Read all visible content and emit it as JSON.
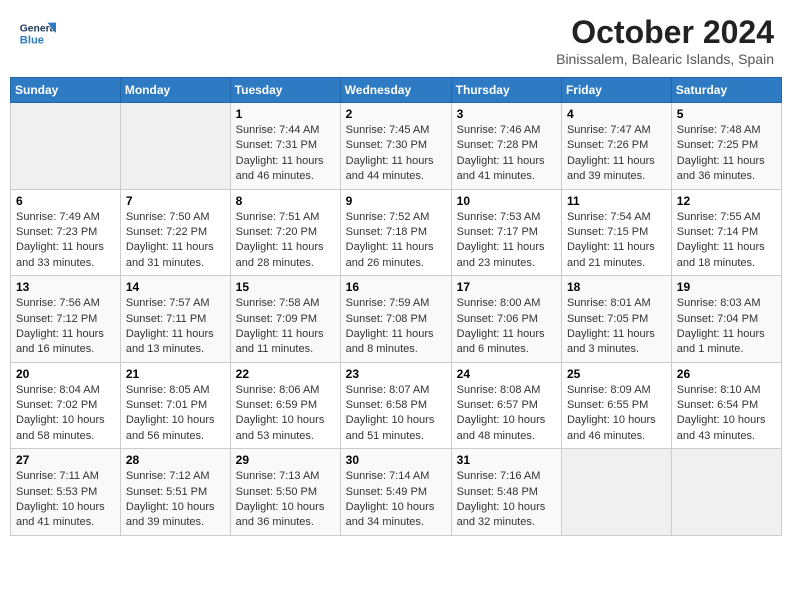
{
  "header": {
    "logo_text_general": "General",
    "logo_text_blue": "Blue",
    "month_title": "October 2024",
    "subtitle": "Binissalem, Balearic Islands, Spain"
  },
  "days_of_week": [
    "Sunday",
    "Monday",
    "Tuesday",
    "Wednesday",
    "Thursday",
    "Friday",
    "Saturday"
  ],
  "weeks": [
    [
      {
        "day": "",
        "data": ""
      },
      {
        "day": "",
        "data": ""
      },
      {
        "day": "1",
        "data": "Sunrise: 7:44 AM\nSunset: 7:31 PM\nDaylight: 11 hours and 46 minutes."
      },
      {
        "day": "2",
        "data": "Sunrise: 7:45 AM\nSunset: 7:30 PM\nDaylight: 11 hours and 44 minutes."
      },
      {
        "day": "3",
        "data": "Sunrise: 7:46 AM\nSunset: 7:28 PM\nDaylight: 11 hours and 41 minutes."
      },
      {
        "day": "4",
        "data": "Sunrise: 7:47 AM\nSunset: 7:26 PM\nDaylight: 11 hours and 39 minutes."
      },
      {
        "day": "5",
        "data": "Sunrise: 7:48 AM\nSunset: 7:25 PM\nDaylight: 11 hours and 36 minutes."
      }
    ],
    [
      {
        "day": "6",
        "data": "Sunrise: 7:49 AM\nSunset: 7:23 PM\nDaylight: 11 hours and 33 minutes."
      },
      {
        "day": "7",
        "data": "Sunrise: 7:50 AM\nSunset: 7:22 PM\nDaylight: 11 hours and 31 minutes."
      },
      {
        "day": "8",
        "data": "Sunrise: 7:51 AM\nSunset: 7:20 PM\nDaylight: 11 hours and 28 minutes."
      },
      {
        "day": "9",
        "data": "Sunrise: 7:52 AM\nSunset: 7:18 PM\nDaylight: 11 hours and 26 minutes."
      },
      {
        "day": "10",
        "data": "Sunrise: 7:53 AM\nSunset: 7:17 PM\nDaylight: 11 hours and 23 minutes."
      },
      {
        "day": "11",
        "data": "Sunrise: 7:54 AM\nSunset: 7:15 PM\nDaylight: 11 hours and 21 minutes."
      },
      {
        "day": "12",
        "data": "Sunrise: 7:55 AM\nSunset: 7:14 PM\nDaylight: 11 hours and 18 minutes."
      }
    ],
    [
      {
        "day": "13",
        "data": "Sunrise: 7:56 AM\nSunset: 7:12 PM\nDaylight: 11 hours and 16 minutes."
      },
      {
        "day": "14",
        "data": "Sunrise: 7:57 AM\nSunset: 7:11 PM\nDaylight: 11 hours and 13 minutes."
      },
      {
        "day": "15",
        "data": "Sunrise: 7:58 AM\nSunset: 7:09 PM\nDaylight: 11 hours and 11 minutes."
      },
      {
        "day": "16",
        "data": "Sunrise: 7:59 AM\nSunset: 7:08 PM\nDaylight: 11 hours and 8 minutes."
      },
      {
        "day": "17",
        "data": "Sunrise: 8:00 AM\nSunset: 7:06 PM\nDaylight: 11 hours and 6 minutes."
      },
      {
        "day": "18",
        "data": "Sunrise: 8:01 AM\nSunset: 7:05 PM\nDaylight: 11 hours and 3 minutes."
      },
      {
        "day": "19",
        "data": "Sunrise: 8:03 AM\nSunset: 7:04 PM\nDaylight: 11 hours and 1 minute."
      }
    ],
    [
      {
        "day": "20",
        "data": "Sunrise: 8:04 AM\nSunset: 7:02 PM\nDaylight: 10 hours and 58 minutes."
      },
      {
        "day": "21",
        "data": "Sunrise: 8:05 AM\nSunset: 7:01 PM\nDaylight: 10 hours and 56 minutes."
      },
      {
        "day": "22",
        "data": "Sunrise: 8:06 AM\nSunset: 6:59 PM\nDaylight: 10 hours and 53 minutes."
      },
      {
        "day": "23",
        "data": "Sunrise: 8:07 AM\nSunset: 6:58 PM\nDaylight: 10 hours and 51 minutes."
      },
      {
        "day": "24",
        "data": "Sunrise: 8:08 AM\nSunset: 6:57 PM\nDaylight: 10 hours and 48 minutes."
      },
      {
        "day": "25",
        "data": "Sunrise: 8:09 AM\nSunset: 6:55 PM\nDaylight: 10 hours and 46 minutes."
      },
      {
        "day": "26",
        "data": "Sunrise: 8:10 AM\nSunset: 6:54 PM\nDaylight: 10 hours and 43 minutes."
      }
    ],
    [
      {
        "day": "27",
        "data": "Sunrise: 7:11 AM\nSunset: 5:53 PM\nDaylight: 10 hours and 41 minutes."
      },
      {
        "day": "28",
        "data": "Sunrise: 7:12 AM\nSunset: 5:51 PM\nDaylight: 10 hours and 39 minutes."
      },
      {
        "day": "29",
        "data": "Sunrise: 7:13 AM\nSunset: 5:50 PM\nDaylight: 10 hours and 36 minutes."
      },
      {
        "day": "30",
        "data": "Sunrise: 7:14 AM\nSunset: 5:49 PM\nDaylight: 10 hours and 34 minutes."
      },
      {
        "day": "31",
        "data": "Sunrise: 7:16 AM\nSunset: 5:48 PM\nDaylight: 10 hours and 32 minutes."
      },
      {
        "day": "",
        "data": ""
      },
      {
        "day": "",
        "data": ""
      }
    ]
  ]
}
